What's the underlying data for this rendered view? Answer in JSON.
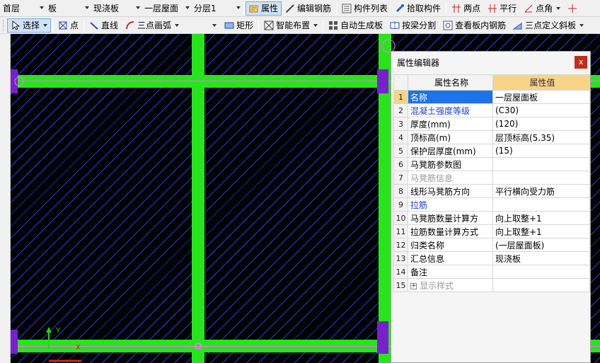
{
  "toolbar1": {
    "floor_combo": "首层",
    "type_combo": "板",
    "subtype_combo": "现浇板",
    "element_combo": "一层屋面",
    "layer_combo": "分层1",
    "buttons": [
      "属性",
      "编辑钢筋",
      "构件列表",
      "拾取构件",
      "两点",
      "平行",
      "点角"
    ]
  },
  "toolbar2": {
    "buttons": [
      "选择",
      "点",
      "直线",
      "三点画弧",
      "矩形",
      "智能布置",
      "自动生成板",
      "按梁分割",
      "查看板内钢筋",
      "三点定义斜板"
    ]
  },
  "canvas": {
    "axis_x_label": "X",
    "axis_y_label": "Y",
    "colors": {
      "background": "#000000",
      "hatch": "#2a3ad8",
      "beam": "#26e51a",
      "column": "#7a1fd0",
      "centerline": "#ff6bff"
    }
  },
  "property_editor": {
    "title": "属性编辑器",
    "close_label": "x",
    "col_name": "属性名称",
    "col_value": "属性值",
    "rows": [
      {
        "num": "1",
        "name": "名称",
        "value": "一层屋面板",
        "style": "selected"
      },
      {
        "num": "2",
        "name": "混凝土强度等级",
        "value": "(C30)",
        "style": "blue"
      },
      {
        "num": "3",
        "name": "厚度(mm)",
        "value": "(120)",
        "style": ""
      },
      {
        "num": "4",
        "name": "顶标高(m)",
        "value": "层顶标高(5.35)",
        "style": ""
      },
      {
        "num": "5",
        "name": "保护层厚度(mm)",
        "value": "(15)",
        "style": ""
      },
      {
        "num": "6",
        "name": "马凳筋参数图",
        "value": "",
        "style": ""
      },
      {
        "num": "7",
        "name": "马凳筋信息",
        "value": "",
        "style": "gray"
      },
      {
        "num": "8",
        "name": "线形马凳筋方向",
        "value": "平行横向受力筋",
        "style": ""
      },
      {
        "num": "9",
        "name": "拉筋",
        "value": "",
        "style": "blue"
      },
      {
        "num": "10",
        "name": "马凳筋数量计算方",
        "value": "向上取整+1",
        "style": ""
      },
      {
        "num": "11",
        "name": "拉筋数量计算方式",
        "value": "向上取整+1",
        "style": ""
      },
      {
        "num": "12",
        "name": "归类名称",
        "value": "(一层屋面板)",
        "style": ""
      },
      {
        "num": "13",
        "name": "汇总信息",
        "value": "现浇板",
        "style": ""
      },
      {
        "num": "14",
        "name": "备注",
        "value": "",
        "style": ""
      },
      {
        "num": "15",
        "name": "显示样式",
        "value": "",
        "style": "gray-expand"
      }
    ]
  }
}
